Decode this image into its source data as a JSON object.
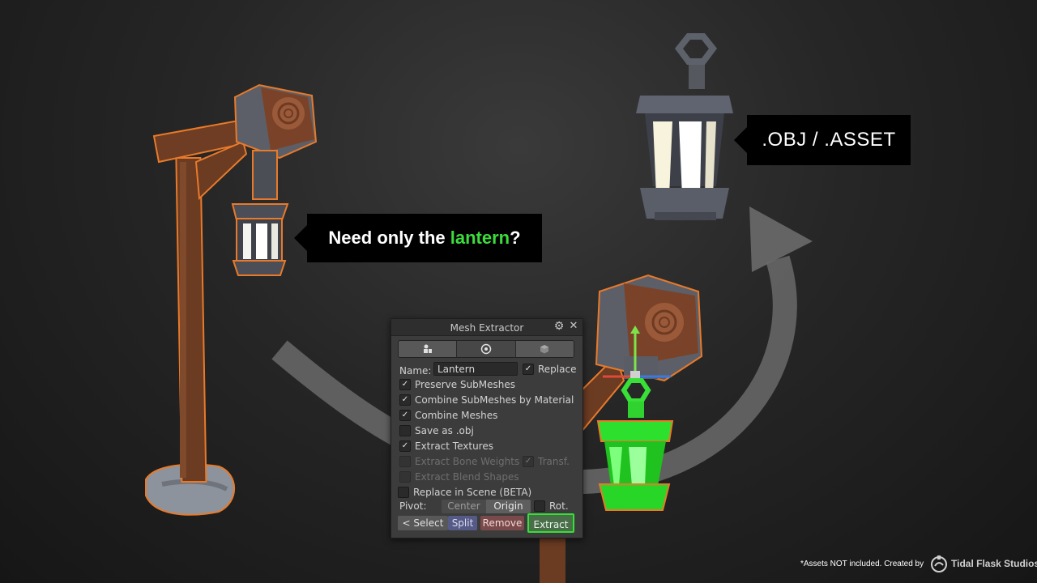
{
  "scene": {
    "callout_lantern": {
      "prefix": "Need only the ",
      "highlight": "lantern",
      "suffix": "?"
    },
    "callout_export": ".OBJ / .ASSET",
    "highlight_color": "#3ddc3d",
    "outline_color": "#e87a2a"
  },
  "panel": {
    "title": "Mesh Extractor",
    "gear_icon": "gear-icon",
    "close_icon": "close-icon",
    "tabs": [
      {
        "icon": "objects-icon",
        "active": false
      },
      {
        "icon": "target-icon",
        "active": true
      },
      {
        "icon": "cube-icon",
        "active": false
      }
    ],
    "name_label": "Name:",
    "name_value": "Lantern",
    "replace_label": "Replace",
    "options": [
      {
        "label": "Preserve SubMeshes",
        "checked": true,
        "enabled": true
      },
      {
        "label": "Combine SubMeshes by Material",
        "checked": true,
        "enabled": true
      },
      {
        "label": "Combine Meshes",
        "checked": true,
        "enabled": true
      },
      {
        "label": "Save as .obj",
        "checked": false,
        "enabled": true
      },
      {
        "label": "Extract Textures",
        "checked": true,
        "enabled": true
      },
      {
        "label": "Extract Bone Weights",
        "checked": false,
        "enabled": false
      },
      {
        "label": "Extract Blend Shapes",
        "checked": false,
        "enabled": false
      },
      {
        "label": "Replace in Scene (BETA)",
        "checked": false,
        "enabled": true
      }
    ],
    "transf_label": "Transf.",
    "pivot_label": "Pivot:",
    "pivot_options": [
      "Center",
      "Origin"
    ],
    "pivot_selected": "Origin",
    "rot_label": "Rot.",
    "buttons": {
      "select": "< Select",
      "split": "Split",
      "remove": "Remove",
      "extract": "Extract"
    },
    "extract_highlight": "#34e234"
  },
  "footer": {
    "note": "*Assets NOT included. Created by",
    "brand": "Tidal Flask Studios"
  }
}
